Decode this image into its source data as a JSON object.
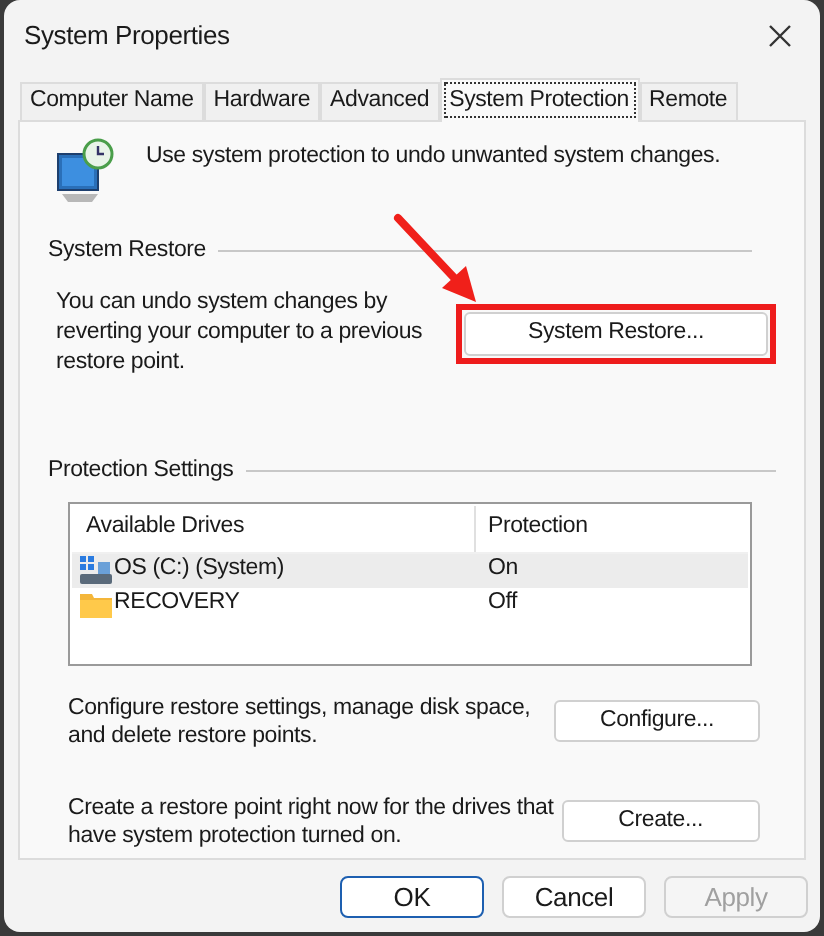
{
  "window": {
    "title": "System Properties"
  },
  "tabs": [
    {
      "label": "Computer Name",
      "selected": false
    },
    {
      "label": "Hardware",
      "selected": false
    },
    {
      "label": "Advanced",
      "selected": false
    },
    {
      "label": "System Protection",
      "selected": true
    },
    {
      "label": "Remote",
      "selected": false
    }
  ],
  "intro": "Use system protection to undo unwanted system changes.",
  "system_restore": {
    "heading": "System Restore",
    "description": "You can undo system changes by reverting your computer to a previous restore point.",
    "button": "System Restore...",
    "highlighted": true
  },
  "protection_settings": {
    "heading": "Protection Settings",
    "columns": [
      "Available Drives",
      "Protection"
    ],
    "rows": [
      {
        "kind": "system",
        "drive": "OS (C:) (System)",
        "protection": "On",
        "selected": true
      },
      {
        "kind": "folder",
        "drive": "RECOVERY",
        "protection": "Off",
        "selected": false
      }
    ],
    "configure": {
      "description": "Configure restore settings, manage disk space, and delete restore points.",
      "button": "Configure..."
    },
    "create": {
      "description": "Create a restore point right now for the drives that have system protection turned on.",
      "button": "Create..."
    }
  },
  "buttons": [
    {
      "label": "OK",
      "kind": "default",
      "disabled": false
    },
    {
      "label": "Cancel",
      "kind": "normal",
      "disabled": false
    },
    {
      "label": "Apply",
      "kind": "normal",
      "disabled": true
    }
  ]
}
